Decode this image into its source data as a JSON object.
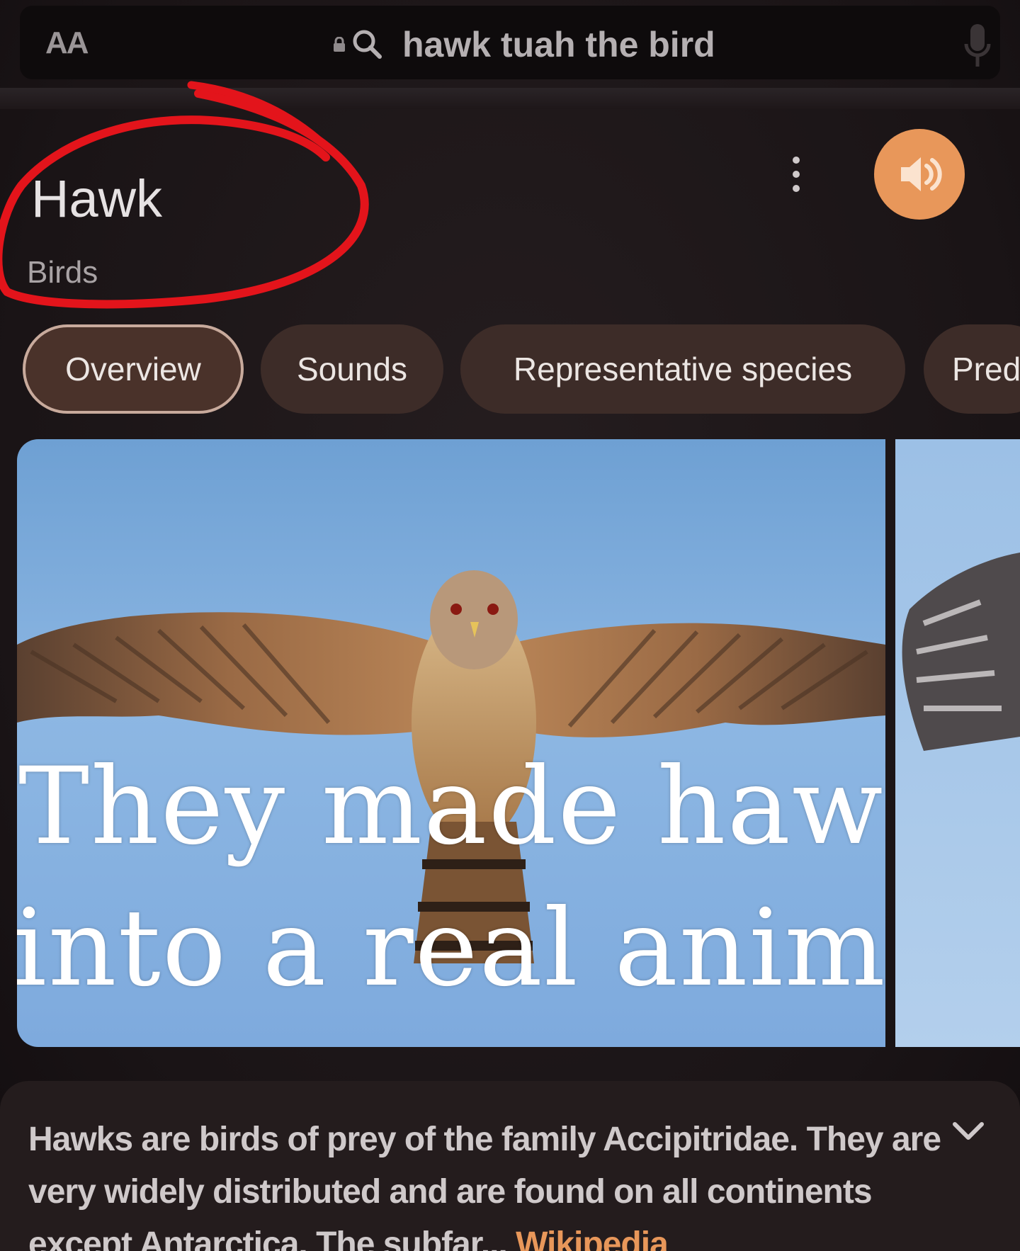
{
  "address_bar": {
    "text_size_label": "AA",
    "query": "hawk tuah the bird"
  },
  "knowledge_panel": {
    "title": "Hawk",
    "subtitle": "Birds",
    "tabs": [
      {
        "label": "Overview",
        "active": true
      },
      {
        "label": "Sounds",
        "active": false
      },
      {
        "label": "Representative species",
        "active": false
      },
      {
        "label": "Pred",
        "active": false
      }
    ],
    "image_caption_line1": "They made hawk tuah",
    "image_caption_line2": "into a real animal",
    "description": "Hawks are birds of prey of the family Accipitridae. They are very widely distributed and are found on all continents except Antarctica. The subfar...",
    "source_link": "Wikipedia"
  },
  "icons": {
    "lock": "lock-icon",
    "search": "search-icon",
    "mic": "mic-icon",
    "more": "more-vert-icon",
    "sound": "speaker-icon",
    "expand": "chevron-down-icon"
  },
  "colors": {
    "background": "#1c1618",
    "accent_orange": "#e8975a",
    "tab_bg": "#3d2c28",
    "annotation_red": "#e3141b"
  }
}
